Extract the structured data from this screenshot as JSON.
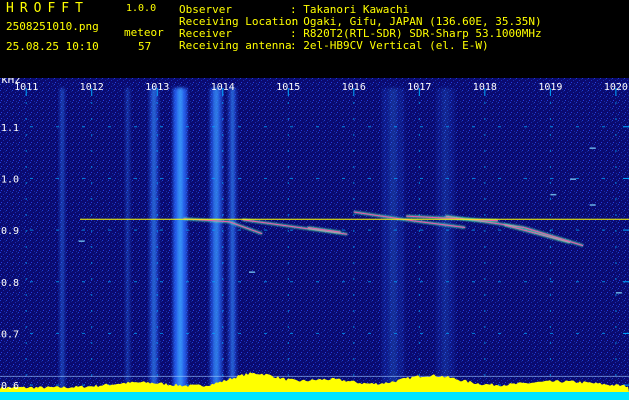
{
  "header": {
    "app_title": "HROFFT",
    "version": "1.0.0",
    "filename": "2508251010.png",
    "datetime": "25.08.25 10:10",
    "count_label": "meteor",
    "count_value": "57",
    "info": [
      {
        "key": "Observer",
        "value": ": Takanori Kawachi"
      },
      {
        "key": "Receiving Location",
        "value": ": Ogaki, Gifu, JAPAN (136.60E, 35.35N)"
      },
      {
        "key": "Receiver",
        "value": ": R820T2(RTL-SDR) SDR-Sharp 53.1000MHz"
      },
      {
        "key": "Receiving antenna",
        "value": ": 2el-HB9CV Vertical (el. E-W)"
      }
    ]
  },
  "spectrogram": {
    "x_unit": "kHz",
    "x_ticks": [
      "1011",
      "1012",
      "1013",
      "1014",
      "1015",
      "1016",
      "1017",
      "1018",
      "1019",
      "1020"
    ],
    "y_ticks": [
      "1.1",
      "1.0",
      "0.9",
      "0.8",
      "0.7",
      "0.6"
    ],
    "x_range": [
      1010.6,
      1020.2
    ],
    "y_range": [
      0.575,
      1.175
    ],
    "colors": {
      "background": "#0a0a70",
      "grid": "#00aaff",
      "tick_label": "#ffffff",
      "carrier": "#ffff00",
      "bottom_fill": "#ffff00",
      "bottom_base": "#00e5ff"
    }
  }
}
